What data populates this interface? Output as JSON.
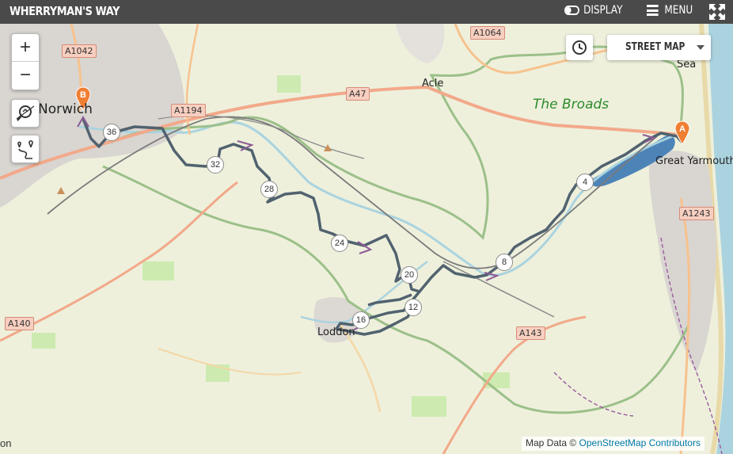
{
  "app": {
    "title": "WHERRYMAN'S WAY"
  },
  "topbar": {
    "display_label": "DISPLAY",
    "menu_label": "MENU"
  },
  "map": {
    "layer_select": {
      "value": "STREET MAP"
    },
    "zoom_in_label": "+",
    "zoom_out_label": "−",
    "attribution": {
      "prefix": "Map Data © ",
      "link": "OpenStreetMap Contributors"
    },
    "edge_text": "on",
    "route_color": "#51626f",
    "markers": {
      "start": "A",
      "end": "B",
      "start_color": "#f07f33"
    },
    "places": {
      "norwich": "Norwich",
      "acle": "Acle",
      "loddon": "Loddon",
      "great_yarmouth": "Great Yarmouth",
      "sea": "Sea",
      "the_broads": "The Broads"
    },
    "roads": {
      "a1042": "A1042",
      "a1064": "A1064",
      "a1194": "A1194",
      "a47": "A47",
      "a1243": "A1243",
      "a140": "A140",
      "a143": "A143"
    },
    "mile_markers": {
      "m4": "4",
      "m8": "8",
      "m12": "12",
      "m16": "16",
      "m20": "20",
      "m24": "24",
      "m28": "28",
      "m32": "32",
      "m36": "36"
    }
  }
}
